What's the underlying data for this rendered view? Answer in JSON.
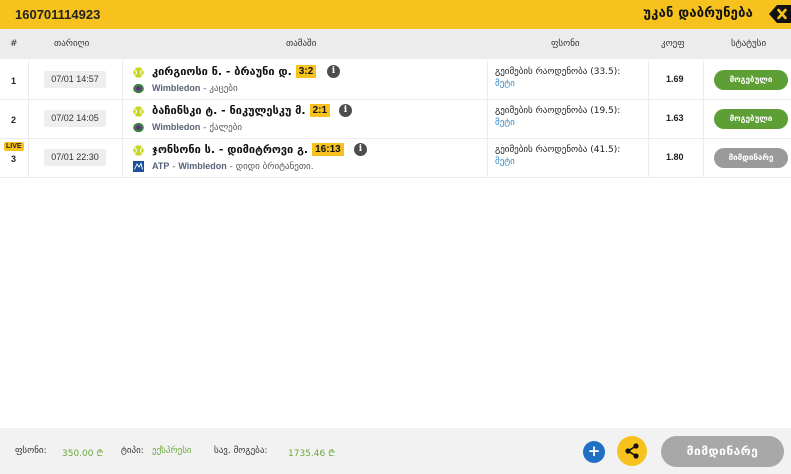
{
  "header": {
    "ticket_id": "160701114923",
    "back_label": "უკან დაბრუნება",
    "close_icon": "close-icon",
    "accent_color": "#f7c21e"
  },
  "columns": {
    "num": "#",
    "date": "თარიღი",
    "match": "თამაში",
    "bet": "ფსონი",
    "odds": "კოეფ",
    "status": "სტატუსი"
  },
  "rows": [
    {
      "num": "1",
      "live": "",
      "date": "07/01 14:57",
      "match": "კირგიოსი ნ. - ბრაუნი დ.",
      "score": "3:2",
      "source": "Wimbledon",
      "category": "კაცები",
      "bet_name": "გეიმების რაოდენობა (33.5):",
      "bet_pick": "მეტი",
      "odds": "1.69",
      "status": "მოგებული",
      "status_kind": "won"
    },
    {
      "num": "2",
      "live": "",
      "date": "07/02 14:05",
      "match": "ბაჩინსკი ტ. - ნიკულესკუ მ.",
      "score": "2:1",
      "source": "Wimbledon",
      "category": "ქალები",
      "bet_name": "გეიმების რაოდენობა (19.5):",
      "bet_pick": "მეტი",
      "odds": "1.63",
      "status": "მოგებული",
      "status_kind": "won"
    },
    {
      "num": "3",
      "live": "LIVE",
      "date": "07/01 22:30",
      "match": "ჯონსონი ს. - დიმიტროვი გ.",
      "score": "16:13",
      "source": "ATP",
      "source2": "Wimbledon",
      "category": "დიდი ბრიტანეთი.",
      "bet_name": "გეიმების რაოდენობა (41.5):",
      "bet_pick": "მეტი",
      "odds": "1.80",
      "status": "მიმდინარე",
      "status_kind": "running"
    }
  ],
  "footer": {
    "stake_label": "ფსონი:",
    "stake_value": "350.00",
    "type_label": "ტიპი:",
    "type_value": "ექსპრესი",
    "win_label": "სავ. მოგება:",
    "win_value": "1735.46",
    "currency": "₾",
    "add_icon": "plus-icon",
    "share_icon": "share-icon",
    "running_label": "მიმდინარე"
  }
}
